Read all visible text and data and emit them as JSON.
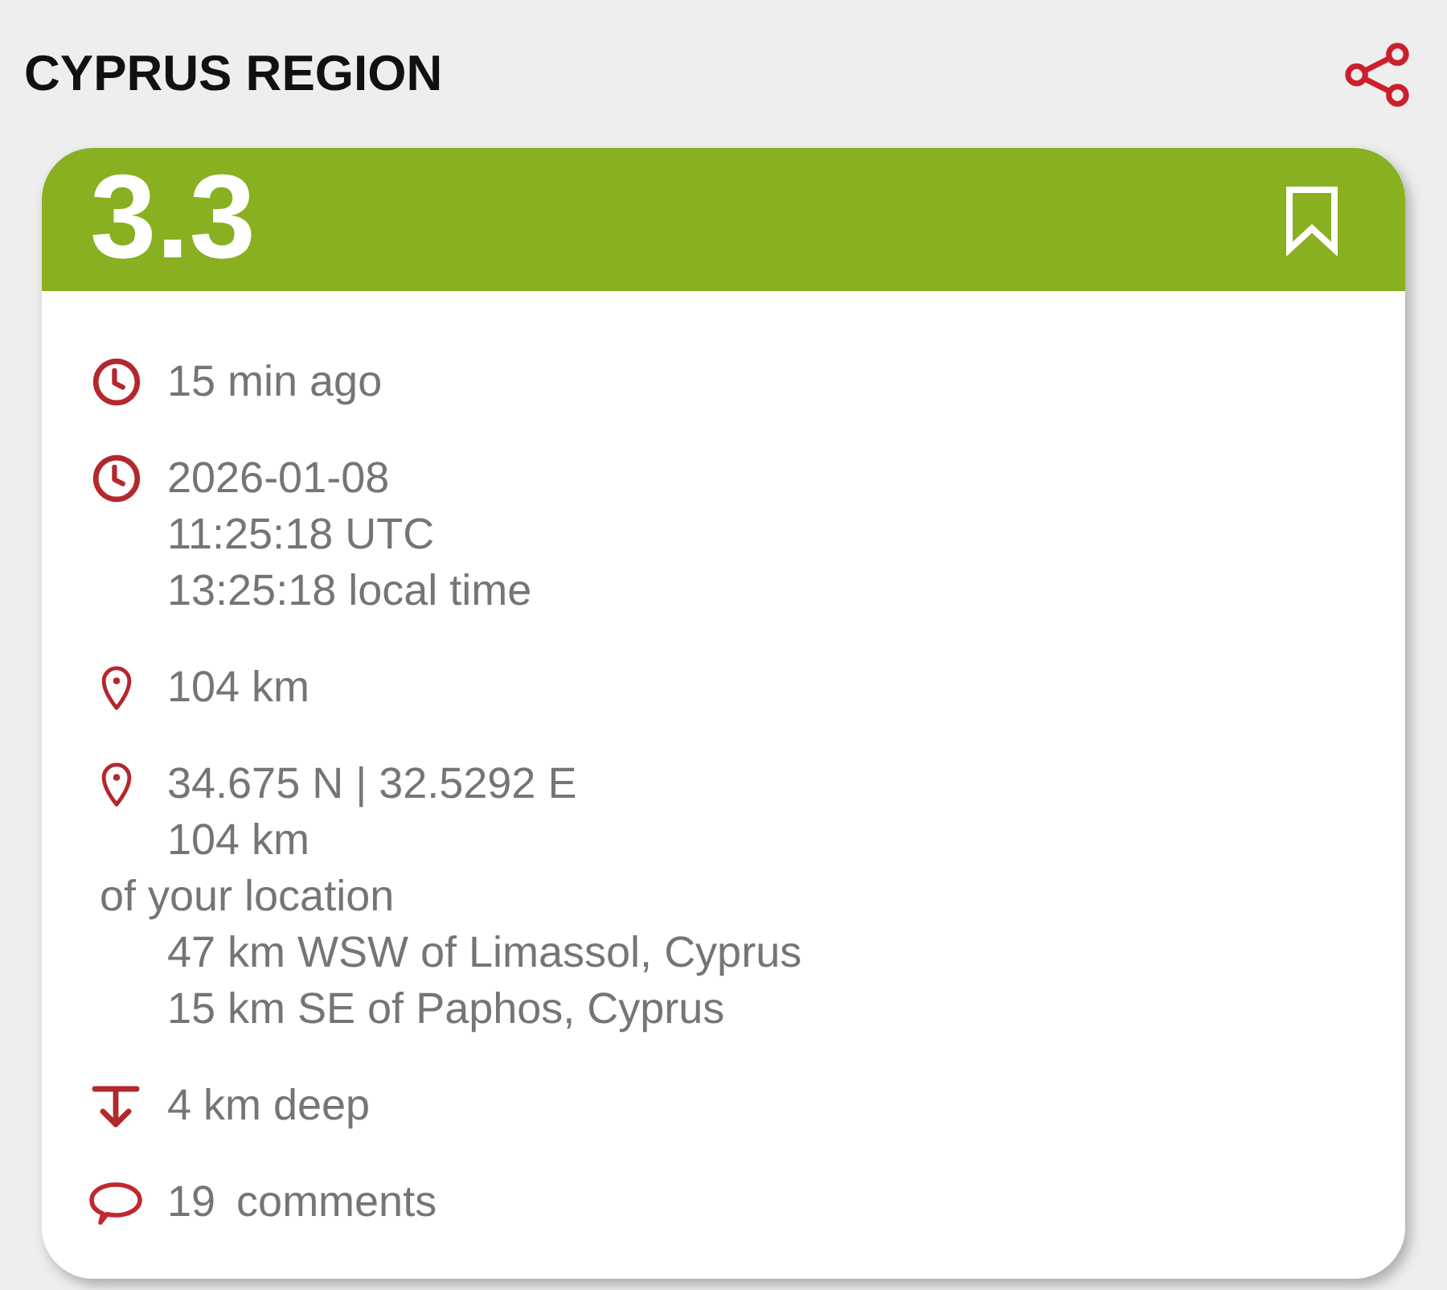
{
  "header": {
    "title": "CYPRUS REGION"
  },
  "card": {
    "magnitude": "3.3",
    "bookmarked": false,
    "details": [
      {
        "kind": "time",
        "lines": [
          "15 min ago"
        ]
      },
      {
        "kind": "time",
        "lines": [
          "2026-01-08",
          "11:25:18 UTC",
          "13:25:18 local time"
        ]
      },
      {
        "kind": "distance",
        "lines": [
          "104 km"
        ]
      },
      {
        "kind": "location",
        "lines": [
          "34.675 N | 32.5292 E",
          "104 km"
        ],
        "note": "of your location",
        "places": [
          "47 km WSW of Limassol, Cyprus",
          "15 km SE of Paphos, Cyprus"
        ]
      },
      {
        "kind": "depth",
        "lines": [
          "4 km deep"
        ]
      },
      {
        "kind": "comments",
        "count": "19",
        "label": "comments"
      }
    ]
  }
}
